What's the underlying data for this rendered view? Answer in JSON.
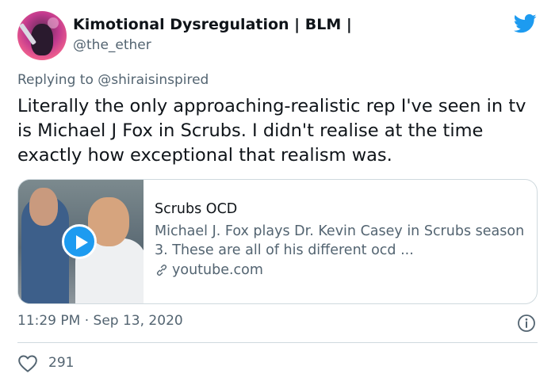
{
  "tweet": {
    "author": {
      "display_name": "Kimotional Dysregulation | BLM |",
      "handle": "@the_ether"
    },
    "reply": {
      "prefix": "Replying to",
      "mention": "@shiraisinspired"
    },
    "text": "Literally the only approaching-realistic rep I've seen in tv is Michael J Fox in Scrubs. I didn't realise at the time exactly how exceptional that realism was.",
    "card": {
      "title": "Scrubs OCD",
      "description": "Michael J. Fox plays Dr. Kevin Casey in Scrubs season 3. These are all of his different ocd ...",
      "domain": "youtube.com"
    },
    "time": "11:29 PM",
    "separator": "·",
    "date": "Sep 13, 2020",
    "likes": "291"
  },
  "colors": {
    "brand_blue": "#1d9bf0",
    "text_primary": "#0f1419",
    "text_secondary": "#536471",
    "border": "#cfd9de"
  },
  "icons": {
    "brand": "twitter-bird-icon",
    "play": "play-icon",
    "link": "link-icon",
    "info": "info-icon",
    "like": "heart-icon"
  }
}
